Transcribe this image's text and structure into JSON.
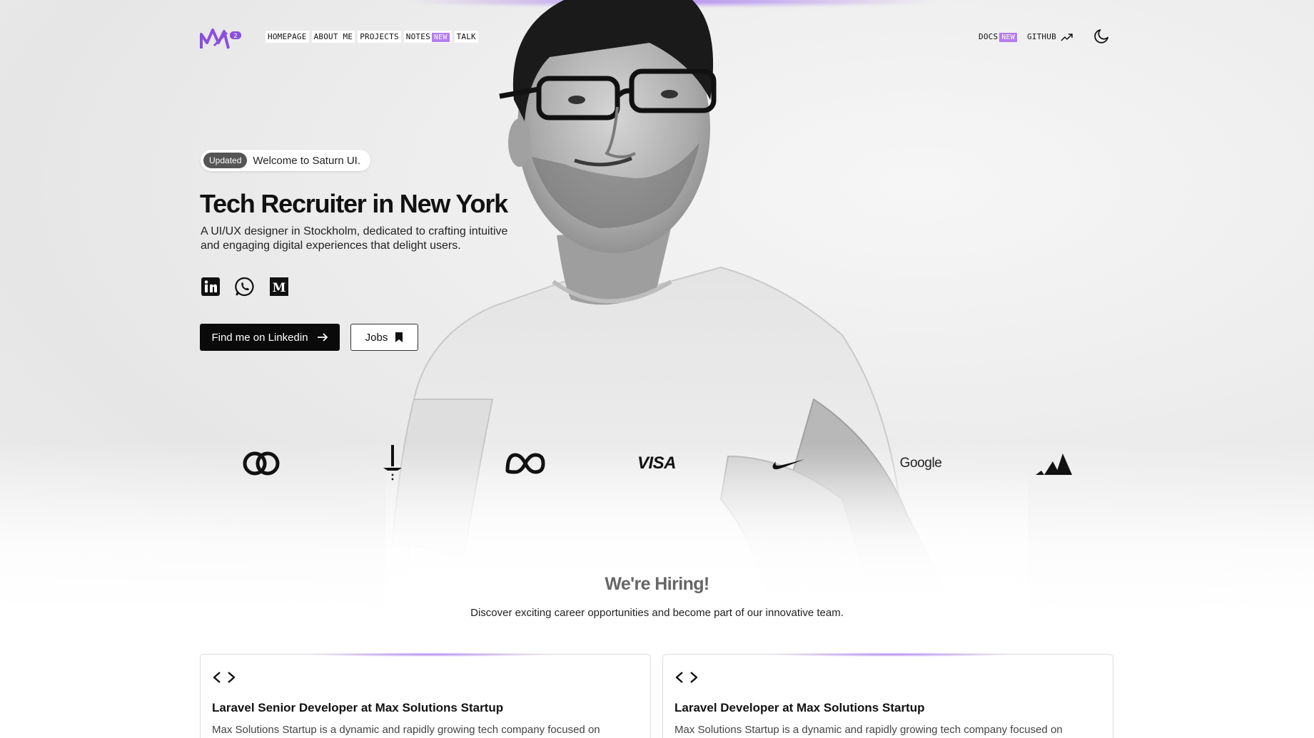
{
  "nav": {
    "logo_badge": "2",
    "items": [
      {
        "label": "HOMEPAGE"
      },
      {
        "label": "ABOUT ME"
      },
      {
        "label": "PROJECTS"
      },
      {
        "label": "NOTES"
      },
      {
        "label": "TALK"
      }
    ],
    "notes_badge": "NEW",
    "right": {
      "docs": "DOCS",
      "docs_badge": "NEW",
      "github": "GITHUB"
    },
    "theme_icon": "moon-icon"
  },
  "hero": {
    "pill_tag": "Updated",
    "pill_text": "Welcome to Saturn UI.",
    "headline": "Tech Recruiter in New York",
    "subline": "A UI/UX designer in Stockholm, dedicated to crafting intuitive and engaging digital experiences that delight users.",
    "socials": [
      "linkedin-icon",
      "whatsapp-icon",
      "medium-icon"
    ],
    "primary_button": "Find me on Linkedin",
    "secondary_button": "Jobs"
  },
  "brands": [
    {
      "name": "mastercard-logo"
    },
    {
      "name": "tesla-like-logo"
    },
    {
      "name": "meta-logo"
    },
    {
      "name": "visa-logo",
      "text": "VISA"
    },
    {
      "name": "nike-logo"
    },
    {
      "name": "google-logo",
      "text": "Google"
    },
    {
      "name": "adidas-logo"
    }
  ],
  "hiring": {
    "title": "We're Hiring!",
    "subtitle": "Discover exciting career opportunities and become part of our innovative team."
  },
  "jobs": [
    {
      "title": "Laravel Senior Developer at Max Solutions Startup",
      "description": "Max Solutions Startup is a dynamic and rapidly growing tech company focused on"
    },
    {
      "title": "Laravel Developer at Max Solutions Startup",
      "description": "Max Solutions Startup is a dynamic and rapidly growing tech company focused on"
    }
  ],
  "colors": {
    "accent": "#b57cf0",
    "primary_button": "#0a0a0a"
  }
}
